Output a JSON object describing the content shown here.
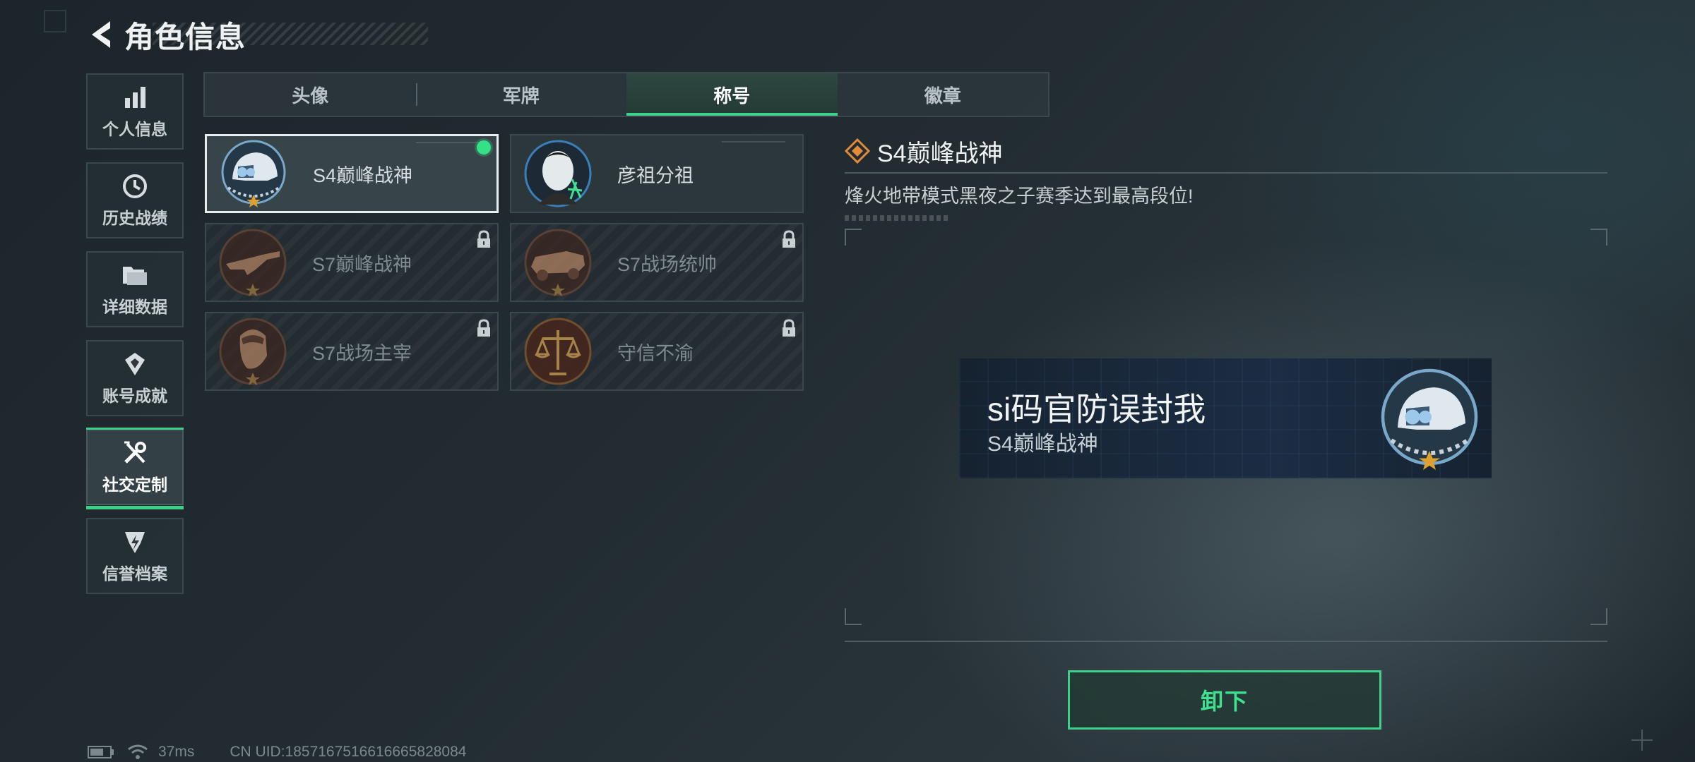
{
  "header": {
    "title": "角色信息"
  },
  "sidebar": {
    "items": [
      {
        "label": "个人信息",
        "icon": "bar-chart-icon"
      },
      {
        "label": "历史战绩",
        "icon": "clock-icon"
      },
      {
        "label": "详细数据",
        "icon": "folder-icon"
      },
      {
        "label": "账号成就",
        "icon": "achievement-icon"
      },
      {
        "label": "社交定制",
        "icon": "tools-icon",
        "active": true
      },
      {
        "label": "信誉档案",
        "icon": "credit-icon"
      }
    ]
  },
  "tabs": [
    {
      "label": "头像"
    },
    {
      "label": "军牌"
    },
    {
      "label": "称号",
      "active": true
    },
    {
      "label": "徽章"
    }
  ],
  "titles": [
    {
      "name": "S4巅峰战神",
      "locked": false,
      "selected": true,
      "equipped": true
    },
    {
      "name": "彦祖分祖",
      "locked": false,
      "selected": false
    },
    {
      "name": "S7巅峰战神",
      "locked": true
    },
    {
      "name": "S7战场统帅",
      "locked": true
    },
    {
      "name": "S7战场主宰",
      "locked": true
    },
    {
      "name": "守信不渝",
      "locked": true
    }
  ],
  "detail": {
    "title": "S4巅峰战神",
    "description": "烽火地带模式黑夜之子赛季达到最高段位!"
  },
  "preview": {
    "player_name": "si码官防误封我",
    "title": "S4巅峰战神"
  },
  "actions": {
    "unequip_label": "卸下"
  },
  "status": {
    "ping": "37ms",
    "uid": "CN UID:1857167516616665828084"
  },
  "colors": {
    "accent": "#3fd08b",
    "equipped_dot": "#33e287",
    "emblem_gold": "#e0a030"
  }
}
